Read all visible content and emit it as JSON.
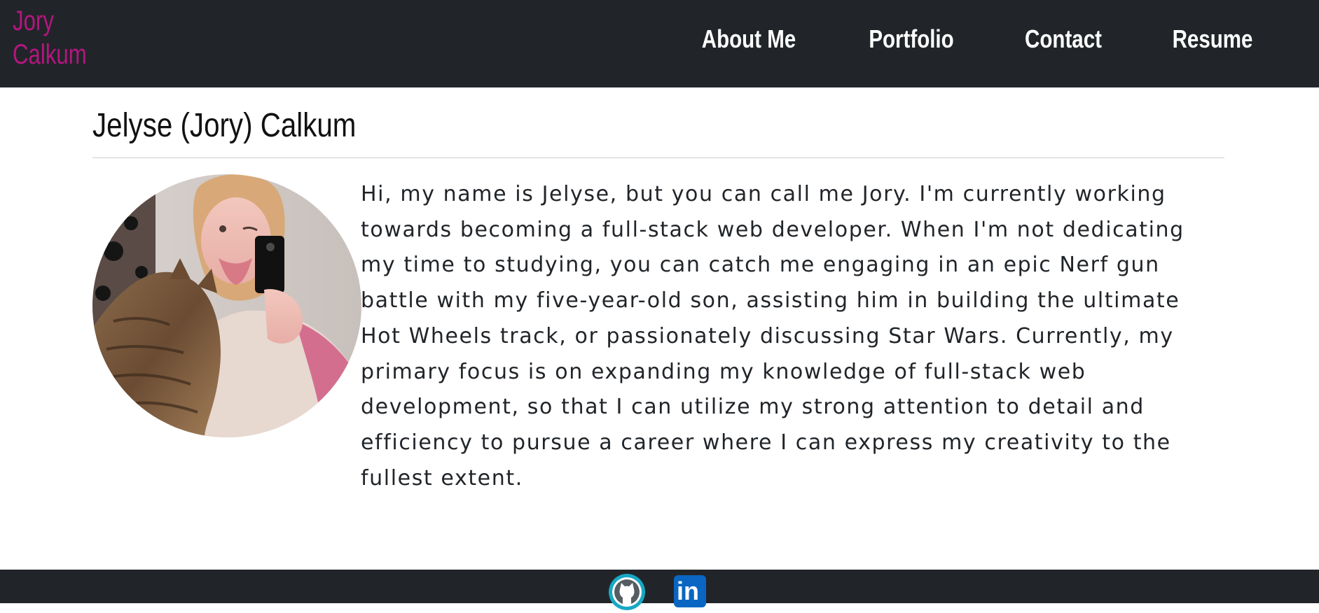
{
  "header": {
    "brand_line1": "Jory",
    "brand_line2": "Calkum",
    "nav": [
      {
        "label": "About Me"
      },
      {
        "label": "Portfolio"
      },
      {
        "label": "Contact"
      },
      {
        "label": "Resume"
      }
    ]
  },
  "main": {
    "title": "Jelyse (Jory) Calkum",
    "bio": "Hi, my name is Jelyse, but you can call me Jory. I'm currently working towards becoming a full-stack web developer. When I'm not dedicating my time to studying, you can catch me engaging in an epic Nerf gun battle with my five-year-old son, assisting him in building the ultimate Hot Wheels track, or passionately discussing Star Wars. Currently, my primary focus is on expanding my knowledge of full-stack web development, so that I can utilize my strong attention to detail and efficiency to pursue a career where I can express my creativity to the fullest extent."
  },
  "footer": {
    "linkedin_mark": "in",
    "icons": [
      "github-icon",
      "linkedin-icon"
    ]
  },
  "colors": {
    "navbar_bg": "#212529",
    "brand": "#b4167f",
    "nav_text": "#ffffff",
    "github": "#17a8c4",
    "linkedin": "#0a66c2"
  }
}
